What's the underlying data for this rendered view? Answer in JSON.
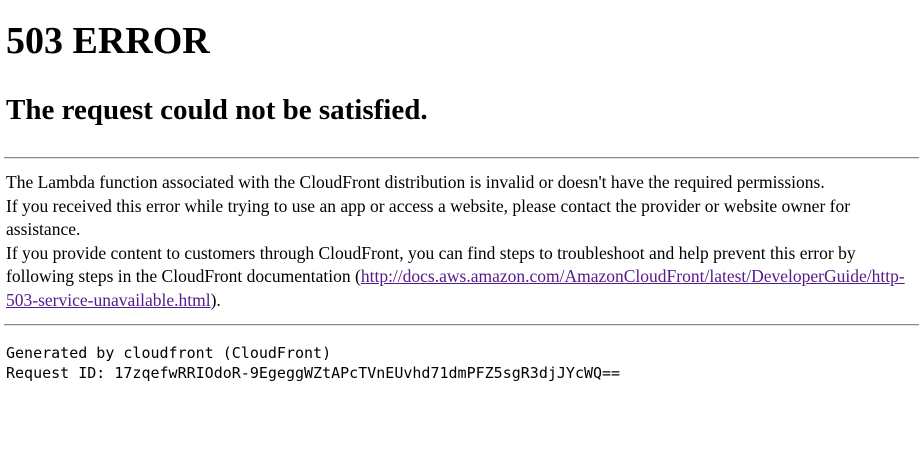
{
  "error": {
    "code_title": "503 ERROR",
    "subtitle": "The request could not be satisfied."
  },
  "message": {
    "line1": "The Lambda function associated with the CloudFront distribution is invalid or doesn't have the required permissions.",
    "line2": "If you received this error while trying to use an app or access a website, please contact the provider or website owner for assistance.",
    "line3": "If you provide content to customers through CloudFront, you can find steps to troubleshoot and help prevent this error by following steps in the CloudFront documentation",
    "link_open_paren": "(",
    "link_text": "http://docs.aws.amazon.com/AmazonCloudFront/latest/DeveloperGuide/http-503-service-unavailable.html",
    "link_href": "http://docs.aws.amazon.com/AmazonCloudFront/latest/DeveloperGuide/http-503-service-unavailable.html",
    "link_close": ")."
  },
  "footer": {
    "generated_by": "Generated by cloudfront (CloudFront)",
    "request_id": "Request ID: 17zqefwRRIOdoR-9EgeggWZtAPcTVnEUvhd71dmPFZ5sgR3djJYcWQ=="
  }
}
